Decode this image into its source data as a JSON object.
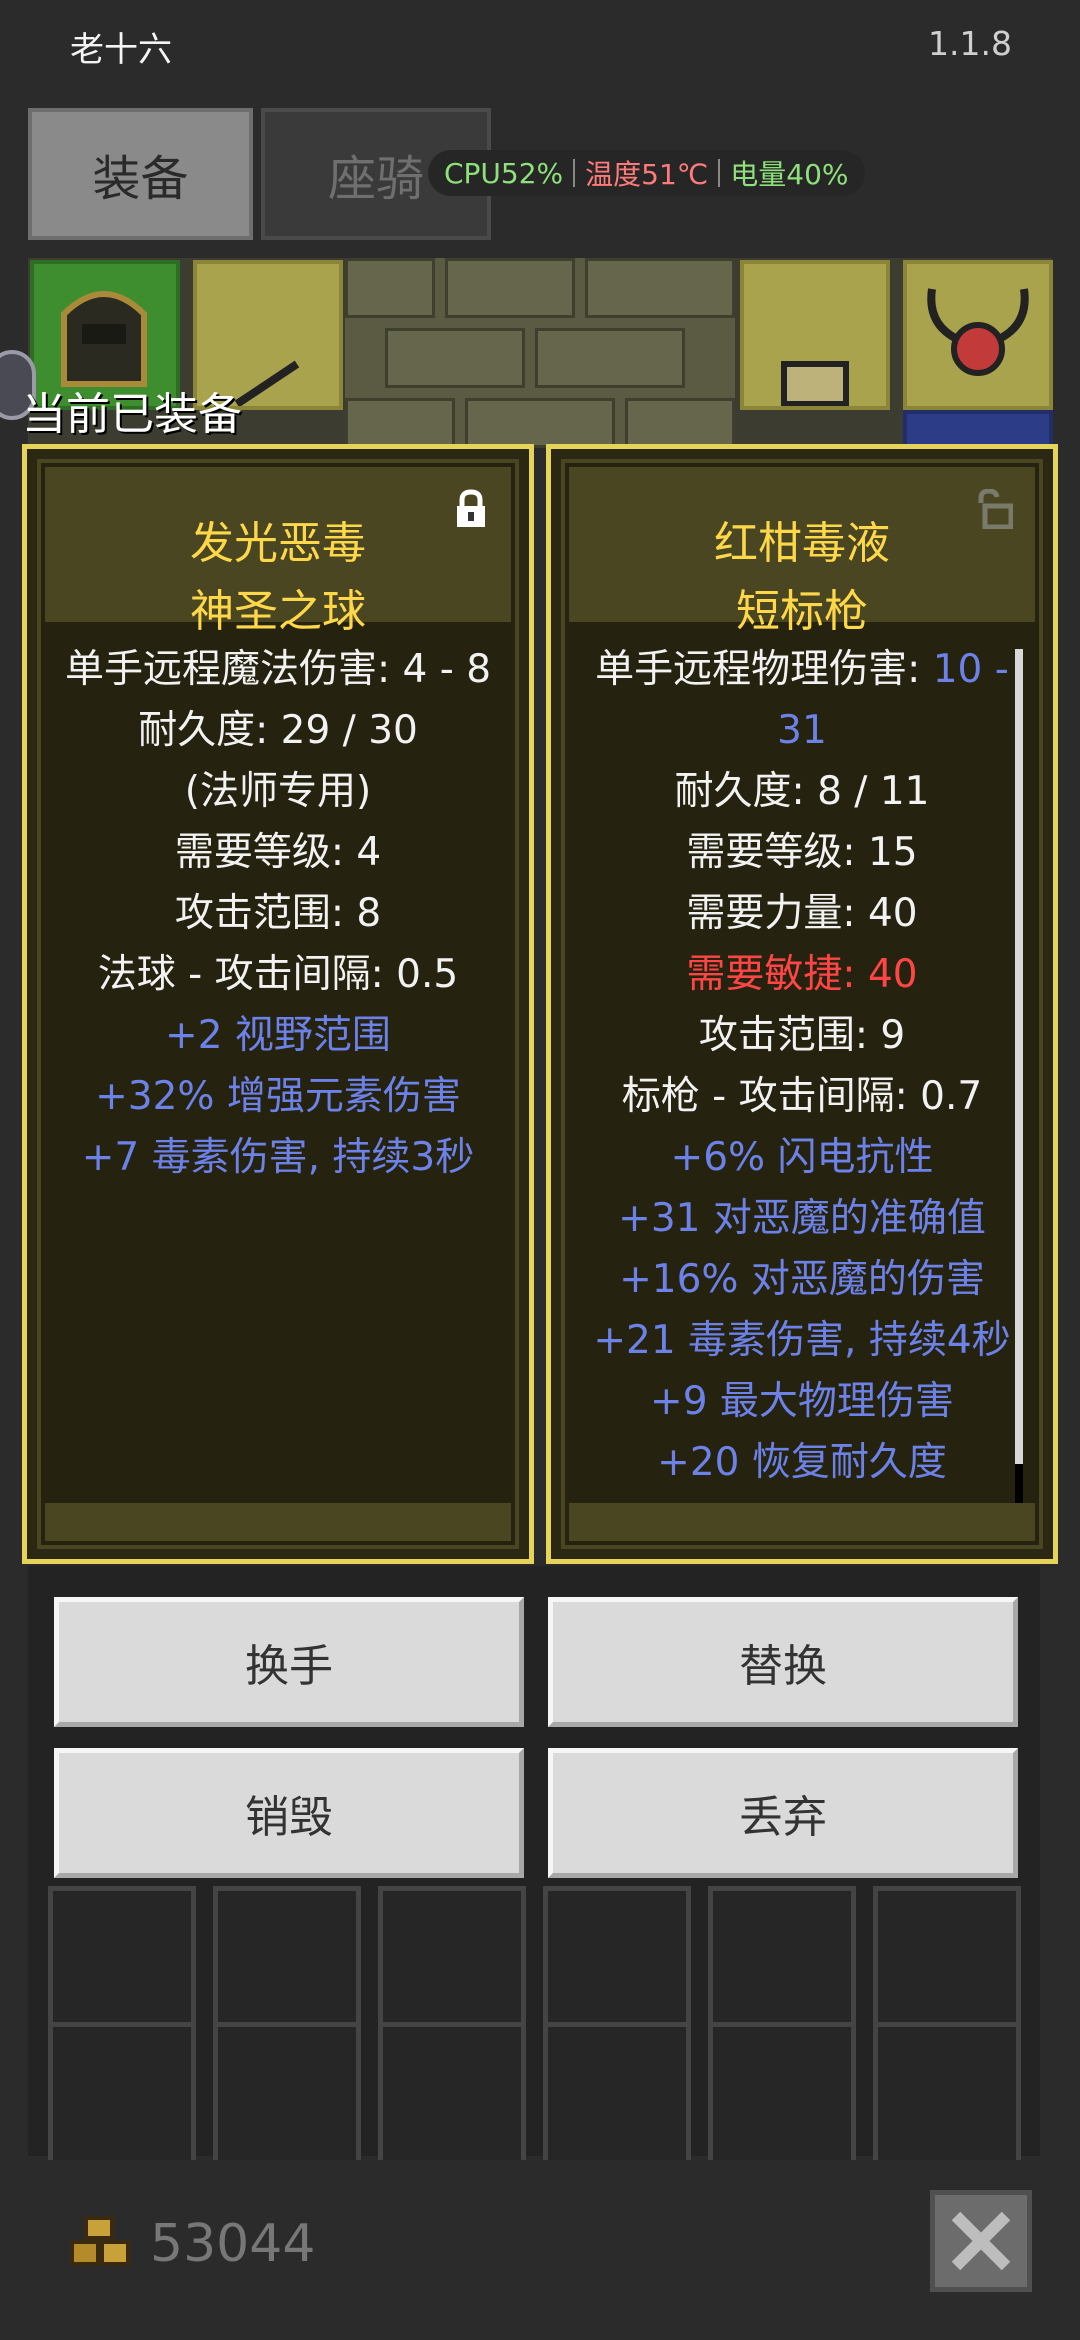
{
  "status_bar": {
    "left_text": "老十六",
    "version": "1.1.8"
  },
  "tabs": [
    {
      "label": "装备",
      "active": true
    },
    {
      "label": "座骑",
      "active": false
    }
  ],
  "system": {
    "cpu": "CPU52%",
    "temp": "温度51℃",
    "battery": "电量40%"
  },
  "equipped_title": "当前已装备",
  "cards": {
    "left": {
      "name_line1": "发光恶毒",
      "name_line2": "神圣之球",
      "locked": true,
      "stats": [
        "单手远程魔法伤害: 4 - 8",
        "耐久度: 29 / 30",
        "(法师专用)",
        "需要等级: 4",
        "攻击范围: 8",
        "法球 - 攻击间隔: 0.5",
        "+2 视野范围",
        "+32% 增强元素伤害",
        "+7 毒素伤害, 持续3秒"
      ]
    },
    "right": {
      "name_line1": "红柑毒液",
      "name_line2": "短标枪",
      "locked": false,
      "stat_damage_label": "单手远程物理伤害: ",
      "stat_damage_value_a": "10 -",
      "stat_damage_value_b": "31",
      "stats": [
        "耐久度: 8 / 11",
        "需要等级: 15",
        "需要力量: 40",
        "需要敏捷: 40",
        "攻击范围: 9",
        "标枪 - 攻击间隔: 0.7",
        "+6% 闪电抗性",
        "+31 对恶魔的准确值",
        "+16% 对恶魔的伤害",
        "+21 毒素伤害, 持续4秒",
        "+9 最大物理伤害",
        "+20 恢复耐久度"
      ]
    }
  },
  "buttons": {
    "swap_hand": "换手",
    "replace": "替换",
    "destroy": "销毁",
    "discard": "丢弃"
  },
  "gold": "53044",
  "colors": {
    "name": "#ffd84a",
    "magic": "#6c82e8",
    "unmet": "#ff4545",
    "card_border": "#e5d35a"
  },
  "icons": [
    "coins-icon",
    "close-icon",
    "lock-icon",
    "unlock-icon"
  ]
}
